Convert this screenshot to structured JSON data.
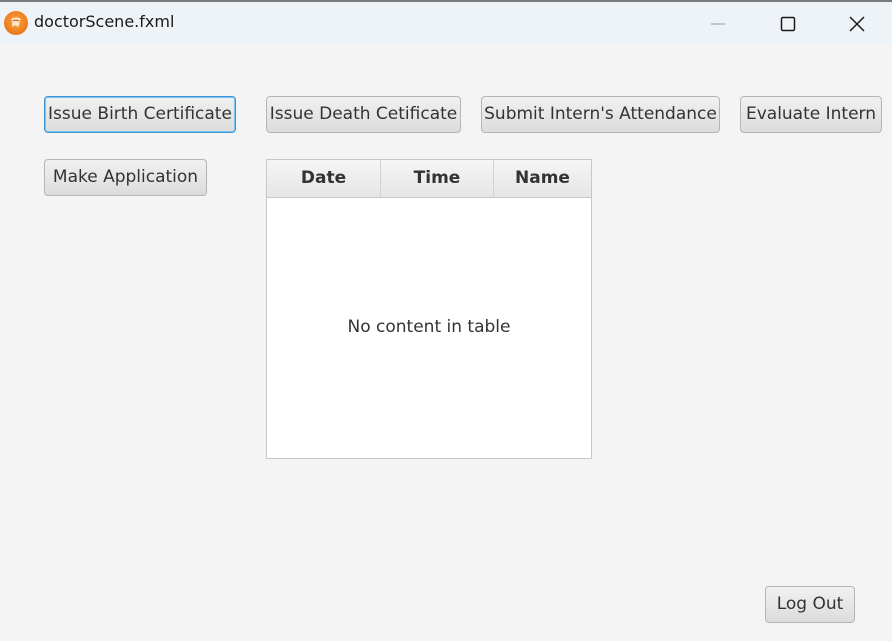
{
  "window": {
    "title": "doctorScene.fxml",
    "app_icon": "javafx-icon"
  },
  "toolbar": {
    "issue_birth_label": "Issue Birth Certificate",
    "issue_death_label": "Issue Death Cetificate",
    "submit_attendance_label": "Submit Intern's Attendance",
    "evaluate_intern_label": "Evaluate Intern",
    "make_application_label": "Make Application"
  },
  "table": {
    "columns": [
      "Date",
      "Time",
      "Name"
    ],
    "rows": [],
    "placeholder": "No content in table"
  },
  "footer": {
    "logout_label": "Log Out"
  },
  "colors": {
    "window_bg": "#f4f4f4",
    "titlebar_bg": "#eef3f7",
    "focus_accent": "#3a97d6",
    "icon_orange": "#ef7f22"
  }
}
